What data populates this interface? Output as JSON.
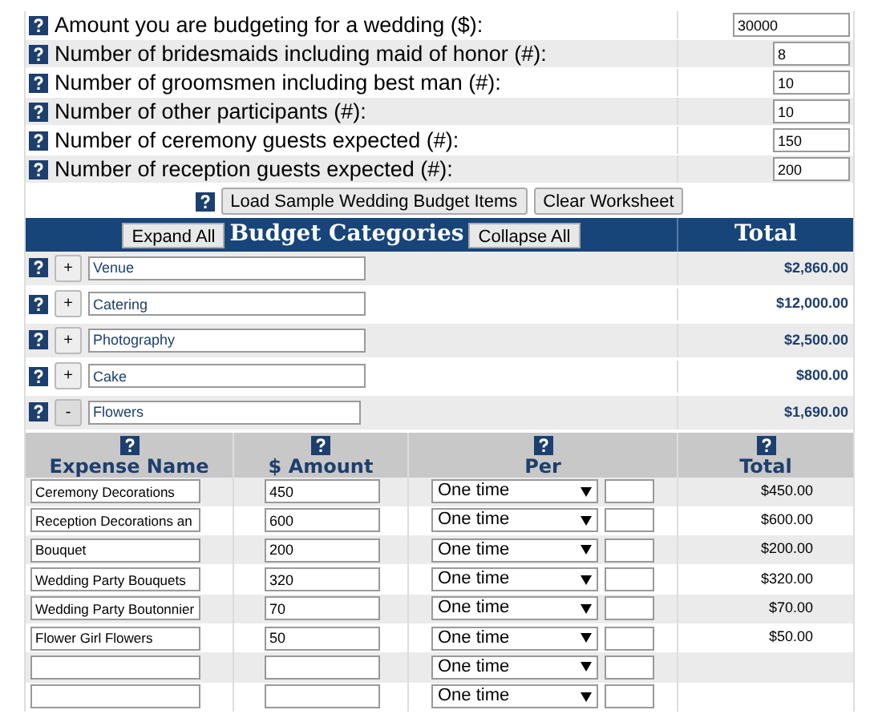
{
  "inputs": [
    {
      "label": "Amount you are budgeting for a wedding ($):",
      "value": "30000",
      "wide": true
    },
    {
      "label": "Number of bridesmaids including maid of honor (#):",
      "value": "8",
      "wide": false
    },
    {
      "label": "Number of groomsmen including best man (#):",
      "value": "10",
      "wide": false
    },
    {
      "label": "Number of other participants (#):",
      "value": "10",
      "wide": false
    },
    {
      "label": "Number of ceremony guests expected (#):",
      "value": "150",
      "wide": false
    },
    {
      "label": "Number of reception guests expected (#):",
      "value": "200",
      "wide": false
    }
  ],
  "actions": [
    "Load Sample Wedding Budget Items",
    "Clear Worksheet"
  ],
  "header": {
    "expand_all": "Expand All",
    "title": "Budget Categories",
    "collapse_all": "Collapse All",
    "total": "Total"
  },
  "categories": [
    {
      "toggle": "+",
      "name": "Venue",
      "total": "$2,860.00",
      "expanded": false
    },
    {
      "toggle": "+",
      "name": "Catering",
      "total": "$12,000.00",
      "expanded": false
    },
    {
      "toggle": "+",
      "name": "Photography",
      "total": "$2,500.00",
      "expanded": false
    },
    {
      "toggle": "+",
      "name": "Cake",
      "total": "$800.00",
      "expanded": false
    },
    {
      "toggle": "-",
      "name": "Flowers",
      "total": "$1,690.00",
      "expanded": true,
      "columns": [
        "Expense Name",
        "$ Amount",
        "Per",
        "Total"
      ],
      "items": [
        {
          "name": "Ceremony Decorations",
          "amount": "450",
          "per": "One time",
          "total": "$450.00"
        },
        {
          "name": "Reception Decorations an",
          "amount": "600",
          "per": "One time",
          "total": "$600.00"
        },
        {
          "name": "Bouquet",
          "amount": "200",
          "per": "One time",
          "total": "$200.00"
        },
        {
          "name": "Wedding Party Bouquets",
          "amount": "320",
          "per": "One time",
          "total": "$320.00"
        },
        {
          "name": "Wedding Party Boutonnier",
          "amount": "70",
          "per": "One time",
          "total": "$70.00"
        },
        {
          "name": "Flower Girl Flowers",
          "amount": "50",
          "per": "One time",
          "total": "$50.00"
        },
        {
          "per": "One time"
        },
        {
          "per": "One time"
        }
      ]
    }
  ]
}
